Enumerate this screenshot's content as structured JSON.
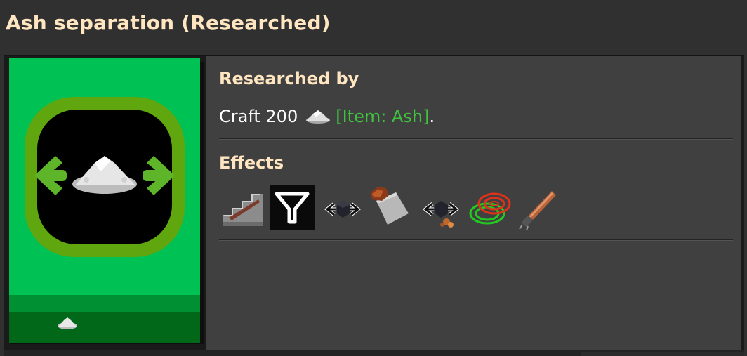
{
  "window": {
    "title": "Ash separation (Researched)"
  },
  "researched_by": {
    "heading": "Researched by",
    "prefix": "Craft 200",
    "item_icon": "ash-icon",
    "item_link": "[Item: Ash]",
    "suffix": "."
  },
  "effects": {
    "heading": "Effects",
    "icons": [
      "stair-tiles-icon",
      "funnel-icon",
      "coal-separation-icon",
      "iron-ore-on-plate-icon",
      "coal-copper-separation-icon",
      "red-green-wire-icon",
      "copper-cable-tool-icon"
    ]
  },
  "technology_card": {
    "icon": "ash-separation-icon",
    "cost_icon": "ash-icon"
  },
  "colors": {
    "title": "#ffe6c0",
    "link": "#3fc33f",
    "card_green": "#00c154"
  }
}
